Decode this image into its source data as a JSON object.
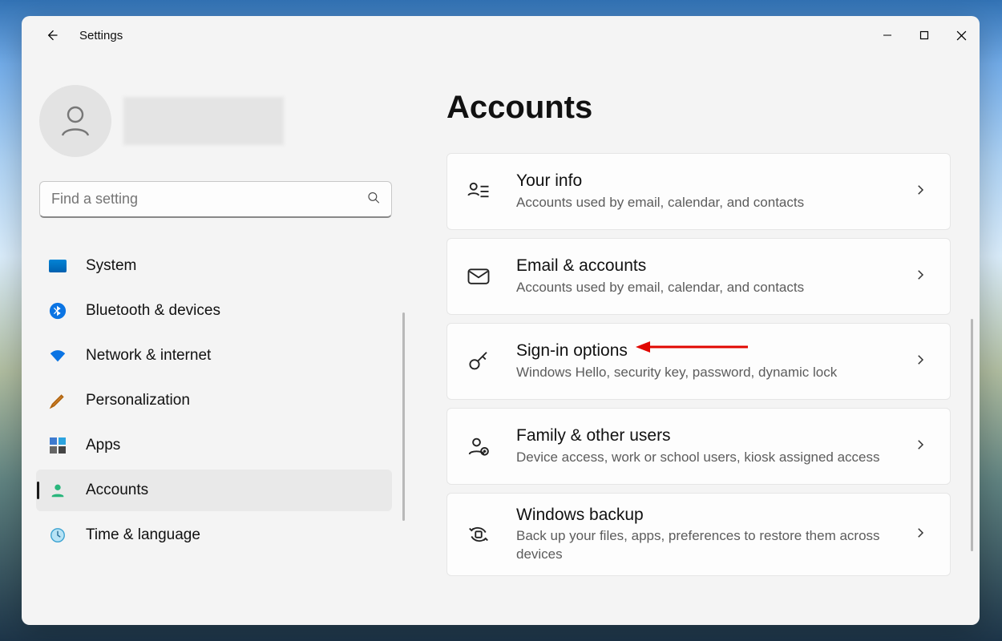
{
  "window": {
    "title": "Settings",
    "page_title": "Accounts"
  },
  "search": {
    "placeholder": "Find a setting"
  },
  "sidebar": {
    "items": [
      {
        "icon": "system-icon",
        "label": "System"
      },
      {
        "icon": "bluetooth-icon",
        "label": "Bluetooth & devices"
      },
      {
        "icon": "network-icon",
        "label": "Network & internet"
      },
      {
        "icon": "personalization-icon",
        "label": "Personalization"
      },
      {
        "icon": "apps-icon",
        "label": "Apps"
      },
      {
        "icon": "accounts-icon",
        "label": "Accounts"
      },
      {
        "icon": "time-icon",
        "label": "Time & language"
      }
    ],
    "selected_index": 5
  },
  "cards": [
    {
      "icon": "your-info-icon",
      "title": "Your info",
      "desc": "Accounts used by email, calendar, and contacts"
    },
    {
      "icon": "mail-icon",
      "title": "Email & accounts",
      "desc": "Accounts used by email, calendar, and contacts"
    },
    {
      "icon": "key-icon",
      "title": "Sign-in options",
      "desc": "Windows Hello, security key, password, dynamic lock"
    },
    {
      "icon": "people-icon",
      "title": "Family & other users",
      "desc": "Device access, work or school users, kiosk assigned access"
    },
    {
      "icon": "backup-icon",
      "title": "Windows backup",
      "desc": "Back up your files, apps, preferences to restore them across devices"
    }
  ],
  "annotation": {
    "arrow_points_to": "Sign-in options",
    "color": "#e10600"
  }
}
